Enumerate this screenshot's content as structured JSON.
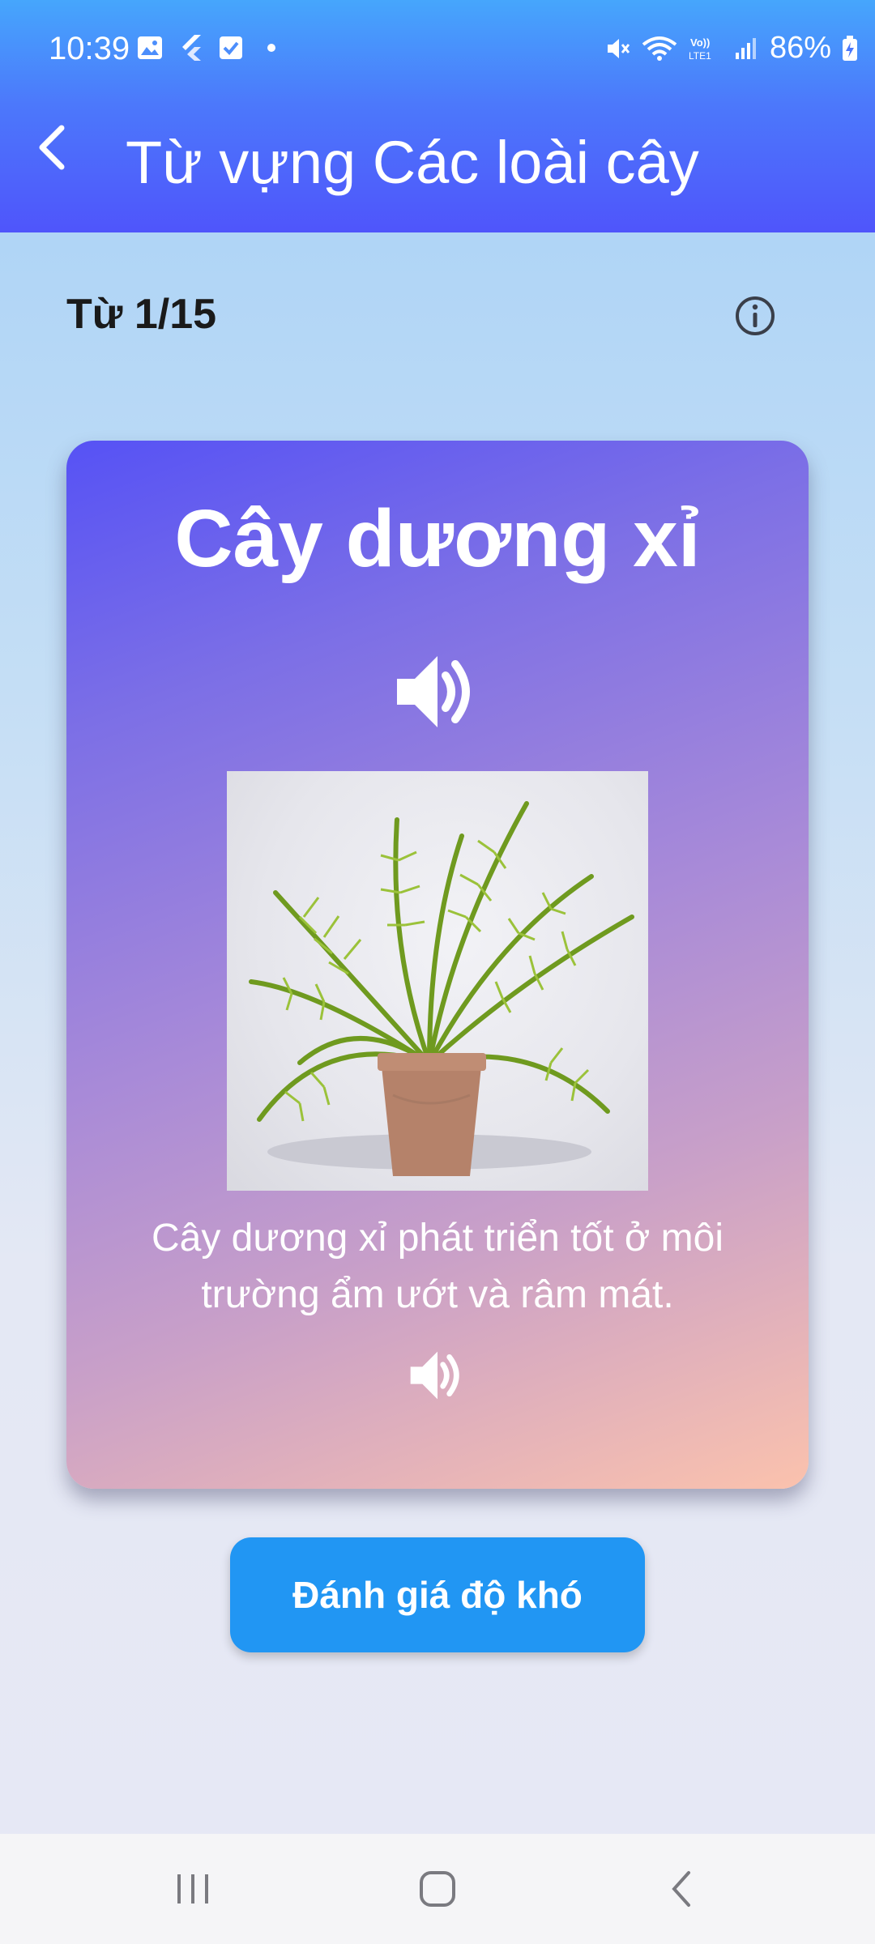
{
  "status_bar": {
    "time": "10:39",
    "battery": "86%",
    "left_icons": [
      "gallery-icon",
      "flutter-icon",
      "check-icon",
      "dot-icon"
    ],
    "right_icons": [
      "mute-icon",
      "wifi-icon",
      "volte-icon",
      "signal-icon",
      "battery-icon"
    ]
  },
  "app_bar": {
    "title": "Từ vựng Các loài cây",
    "back_icon": "chevron-left-icon"
  },
  "progress": {
    "label": "Từ 1/15"
  },
  "card": {
    "word": "Cây dương xỉ",
    "image_alt": "fern-in-pot",
    "example": "Cây dương xỉ phát triển tốt ở môi trường ẩm ướt và râm mát."
  },
  "actions": {
    "rate_label": "Đánh giá độ khó"
  },
  "colors": {
    "appbar_top": "#46a6fc",
    "appbar_bottom": "#4f55fb",
    "button": "#2196f3",
    "card_start": "#5652f5",
    "card_end": "#fbc2ad"
  }
}
